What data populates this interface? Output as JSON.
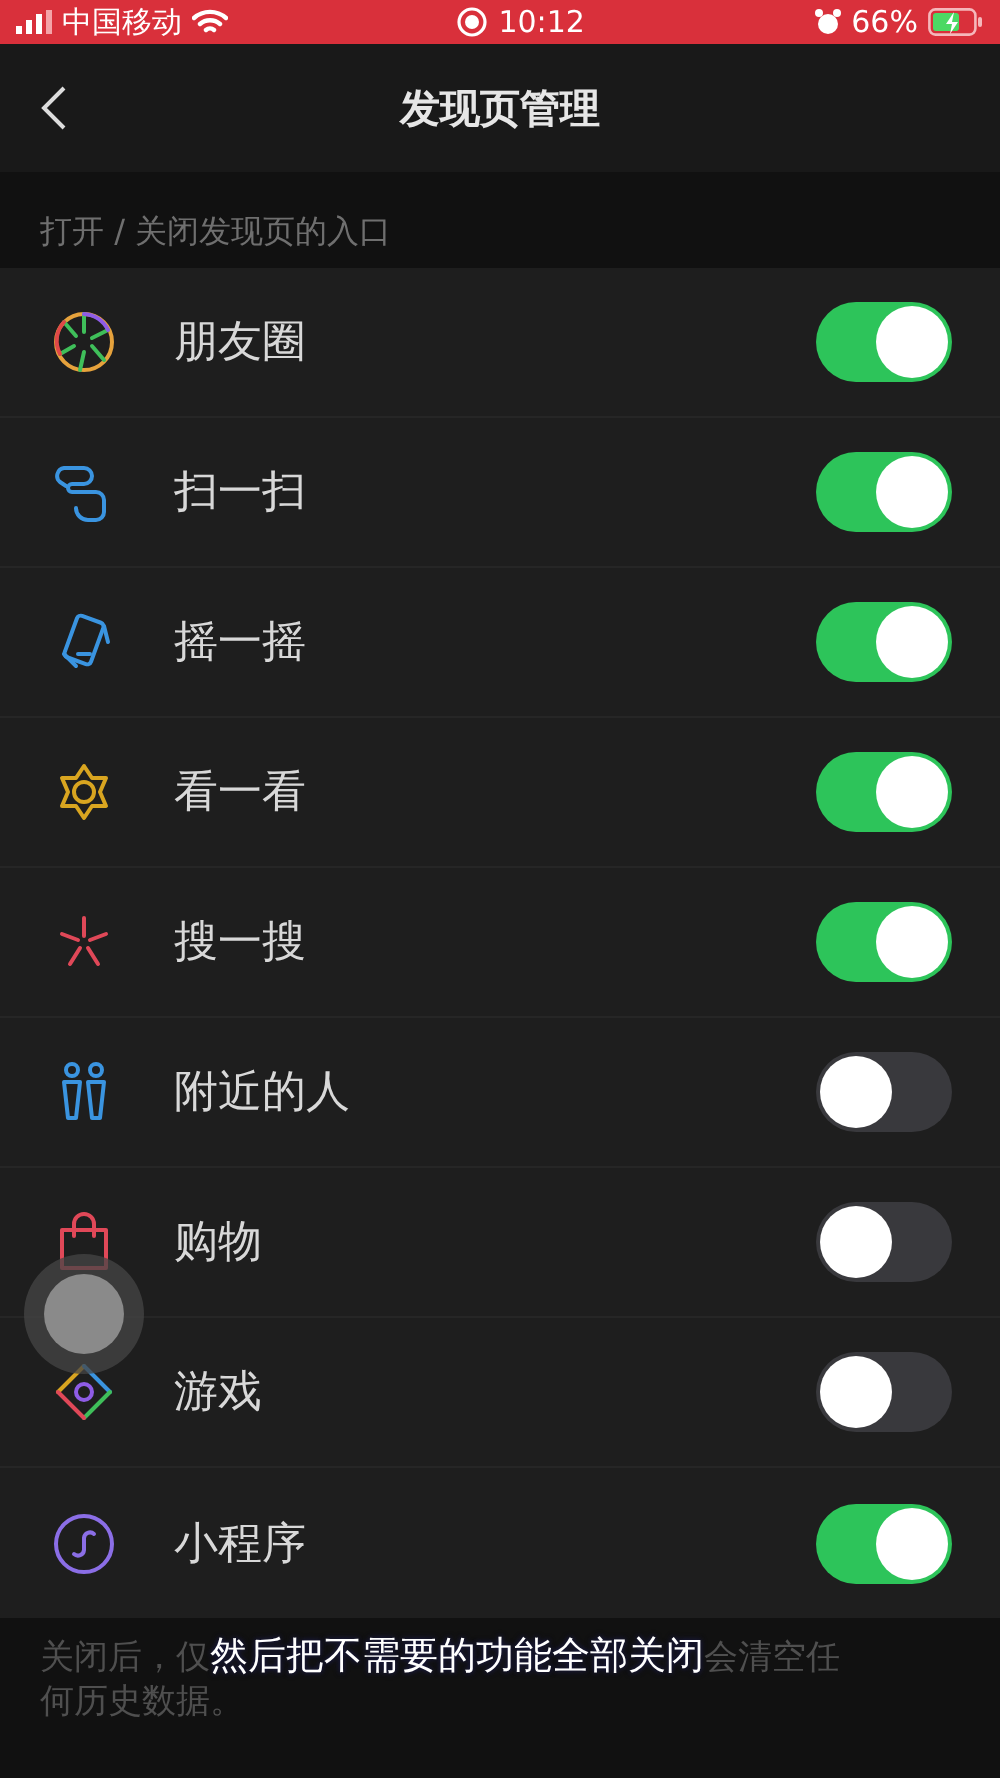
{
  "status_bar": {
    "carrier": "中国移动",
    "time": "10:12",
    "battery": "66%"
  },
  "nav": {
    "title": "发现页管理"
  },
  "section_label": "打开 / 关闭发现页的入口",
  "entries": [
    {
      "label": "朋友圈",
      "on": true
    },
    {
      "label": "扫一扫",
      "on": true
    },
    {
      "label": "摇一摇",
      "on": true
    },
    {
      "label": "看一看",
      "on": true
    },
    {
      "label": "搜一搜",
      "on": true
    },
    {
      "label": "附近的人",
      "on": false
    },
    {
      "label": "购物",
      "on": false
    },
    {
      "label": "游戏",
      "on": false
    },
    {
      "label": "小程序",
      "on": true
    }
  ],
  "footer": {
    "line_1_start": "关闭后，仅",
    "line_1_end": "会清空任",
    "line_2": "何历史数据。"
  },
  "subtitle": "然后把不需要的功能全部关闭"
}
